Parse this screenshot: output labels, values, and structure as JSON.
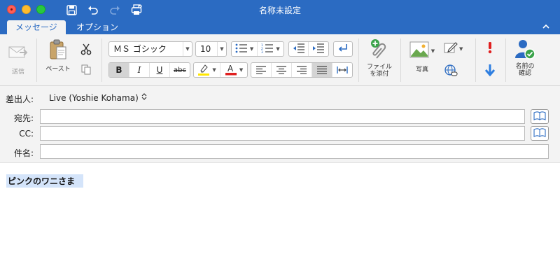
{
  "window": {
    "title": "名称未設定"
  },
  "tabs": [
    {
      "label": "メッセージ",
      "active": true
    },
    {
      "label": "オプション",
      "active": false
    }
  ],
  "ribbon": {
    "send_label": "送信",
    "paste_label": "ペースト",
    "font_name": "ＭＳ ゴシック",
    "font_size": "10",
    "attach_label_line1": "ファイル",
    "attach_label_line2": "を添付",
    "photo_label": "写真",
    "check_names_line1": "名前の",
    "check_names_line2": "確認"
  },
  "fields": {
    "from_label": "差出人:",
    "from_value": "Live (Yoshie Kohama)",
    "to_label": "宛先:",
    "to_value": "",
    "cc_label": "CC:",
    "cc_value": "",
    "subject_label": "件名:",
    "subject_value": ""
  },
  "body": {
    "text": "ピンクのワニさま"
  },
  "colors": {
    "accent": "#2b6bc2",
    "highlight": "#ffe600",
    "font_color": "#e02020",
    "important": "#e02020",
    "low_importance": "#2f7fe0",
    "check_badge": "#3aa34a"
  },
  "icons": [
    "save-icon",
    "undo-icon",
    "redo-icon",
    "print-icon",
    "send-icon",
    "paste-icon",
    "cut-icon",
    "copy-icon",
    "bullets-icon",
    "numbering-icon",
    "outdent-icon",
    "indent-icon",
    "rtl-icon",
    "attach-icon",
    "picture-icon",
    "signature-icon",
    "link-icon",
    "high-importance-icon",
    "low-importance-icon",
    "check-names-icon",
    "address-book-icon"
  ]
}
